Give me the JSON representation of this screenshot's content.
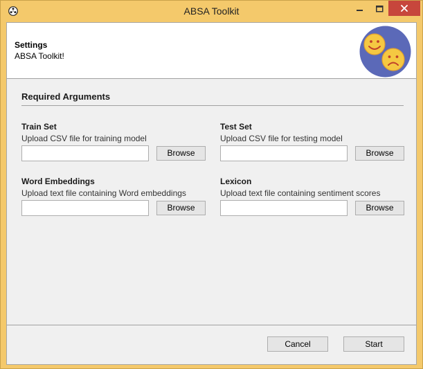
{
  "window": {
    "title": "ABSA Toolkit"
  },
  "header": {
    "title": "Settings",
    "subtitle": "ABSA Toolkit!"
  },
  "section": {
    "title": "Required Arguments"
  },
  "fields": {
    "train": {
      "label": "Train Set",
      "description": "Upload CSV file for training model",
      "value": "",
      "browse_label": "Browse"
    },
    "test": {
      "label": "Test Set",
      "description": "Upload CSV file for testing model",
      "value": "",
      "browse_label": "Browse"
    },
    "embeddings": {
      "label": "Word Embeddings",
      "description": "Upload text file containing Word embeddings",
      "value": "",
      "browse_label": "Browse"
    },
    "lexicon": {
      "label": "Lexicon",
      "description": "Upload text file containing sentiment scores",
      "value": "",
      "browse_label": "Browse"
    }
  },
  "footer": {
    "cancel_label": "Cancel",
    "start_label": "Start"
  },
  "colors": {
    "titlebar": "#f4c96b",
    "close_button": "#c7463c",
    "logo_circle": "#5b69b8",
    "smiley": "#f5c842"
  },
  "icons": {
    "app": "film-reel-icon",
    "logo": "happy-sad-faces-logo"
  }
}
